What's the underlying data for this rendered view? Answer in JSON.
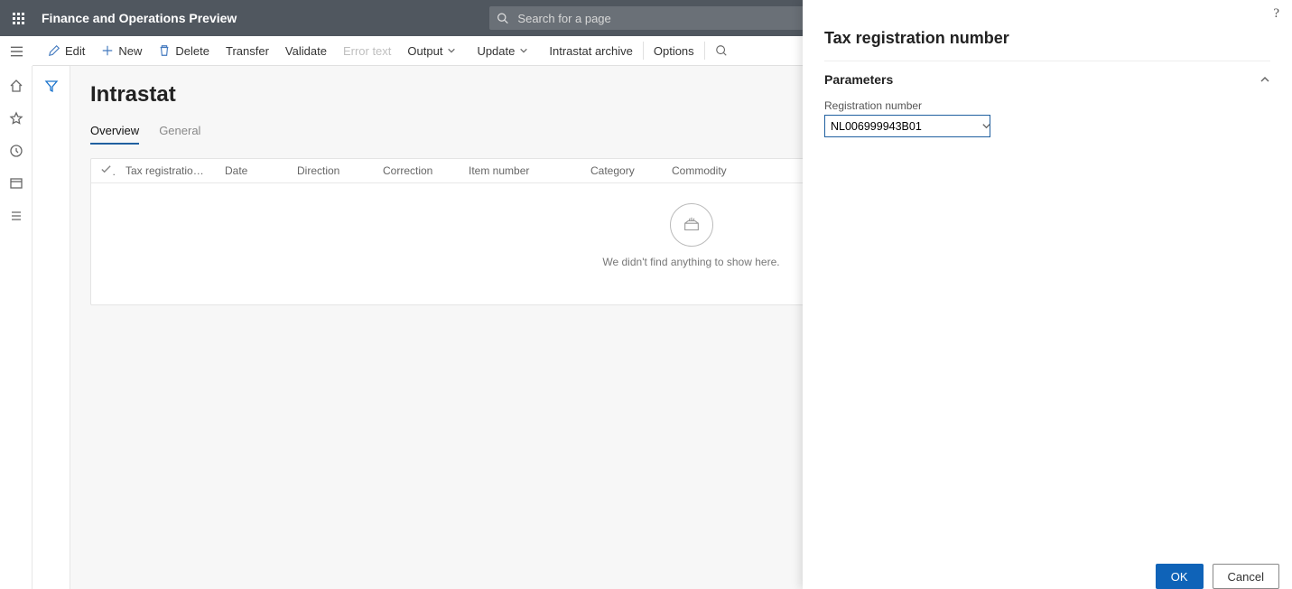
{
  "app": {
    "title": "Finance and Operations Preview"
  },
  "search": {
    "placeholder": "Search for a page"
  },
  "commands": {
    "edit": "Edit",
    "new": "New",
    "delete": "Delete",
    "transfer": "Transfer",
    "validate": "Validate",
    "errortext": "Error text",
    "output": "Output",
    "update": "Update",
    "archive": "Intrastat archive",
    "options": "Options"
  },
  "page": {
    "title": "Intrastat"
  },
  "tabs": {
    "overview": "Overview",
    "general": "General"
  },
  "grid": {
    "columns": [
      "Tax registration num...",
      "Date",
      "Direction",
      "Correction",
      "Item number",
      "Category",
      "Commodity"
    ],
    "empty": "We didn't find anything to show here."
  },
  "panel": {
    "title": "Tax registration number",
    "section": "Parameters",
    "field_label": "Registration number",
    "field_value": "NL006999943B01",
    "ok": "OK",
    "cancel": "Cancel",
    "help": "?"
  }
}
